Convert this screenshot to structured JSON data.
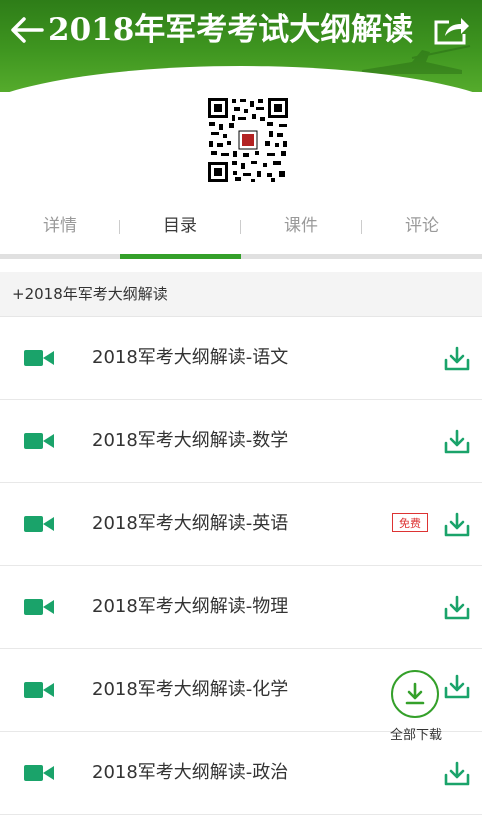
{
  "header": {
    "title": "2018年军考考试大纲解读",
    "back_icon": "arrow-left-icon",
    "share_icon": "share-icon"
  },
  "tabs": [
    {
      "label": "详情",
      "active": false
    },
    {
      "label": "目录",
      "active": true
    },
    {
      "label": "课件",
      "active": false
    },
    {
      "label": "评论",
      "active": false
    }
  ],
  "section": {
    "title": "+2018年军考大纲解读"
  },
  "lessons": [
    {
      "title": "2018军考大纲解读-语文",
      "badge": ""
    },
    {
      "title": "2018军考大纲解读-数学",
      "badge": ""
    },
    {
      "title": "2018军考大纲解读-英语",
      "badge": "免费"
    },
    {
      "title": "2018军考大纲解读-物理",
      "badge": ""
    },
    {
      "title": "2018军考大纲解读-化学",
      "badge": ""
    },
    {
      "title": "2018军考大纲解读-政治",
      "badge": ""
    }
  ],
  "download_all": {
    "label": "全部下载"
  },
  "colors": {
    "accent": "#34a02a",
    "icon": "#1aa36a",
    "header": "#3f9620",
    "badge": "#d33333"
  }
}
